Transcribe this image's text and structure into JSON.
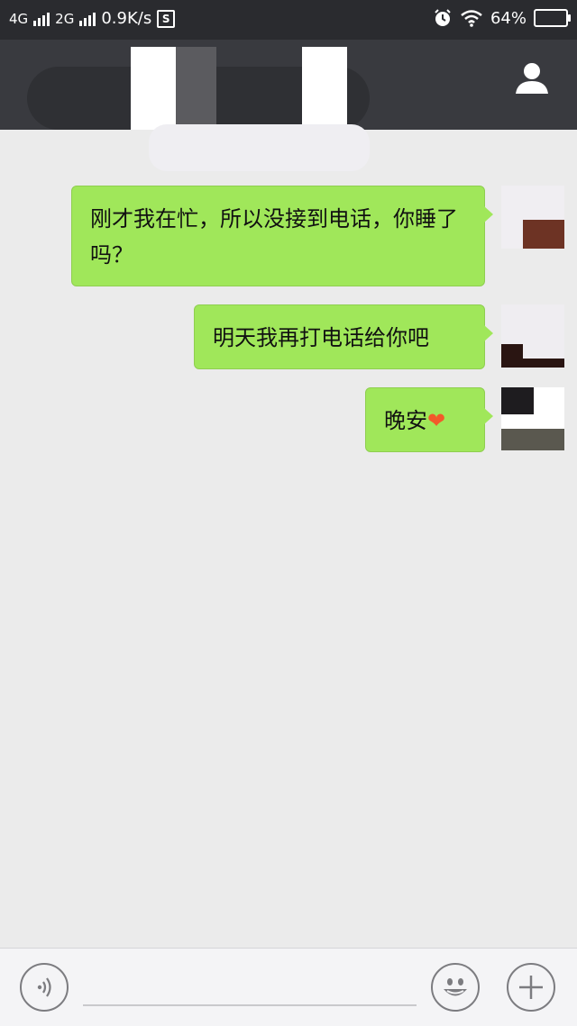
{
  "status_bar": {
    "net1": "4G",
    "net2": "2G",
    "speed": "0.9K/s",
    "s_icon": "S",
    "battery": "64%",
    "icons": [
      "signal-bars-icon",
      "alarm-icon",
      "wifi-icon",
      "battery-icon"
    ]
  },
  "header": {
    "icon": "person-icon"
  },
  "messages": [
    {
      "text": "刚才我在忙，所以没接到电话，你睡了吗？"
    },
    {
      "text": "明天我再打电话给你吧"
    },
    {
      "text": "晚安",
      "emoji": "❤"
    }
  ],
  "input_bar": {
    "icons": [
      "voice-icon",
      "emoji-icon",
      "plus-icon"
    ]
  },
  "colors": {
    "bubble": "#a0e75a",
    "header": "#393a3f",
    "background": "#ebebeb",
    "heart": "#f25a2a"
  }
}
